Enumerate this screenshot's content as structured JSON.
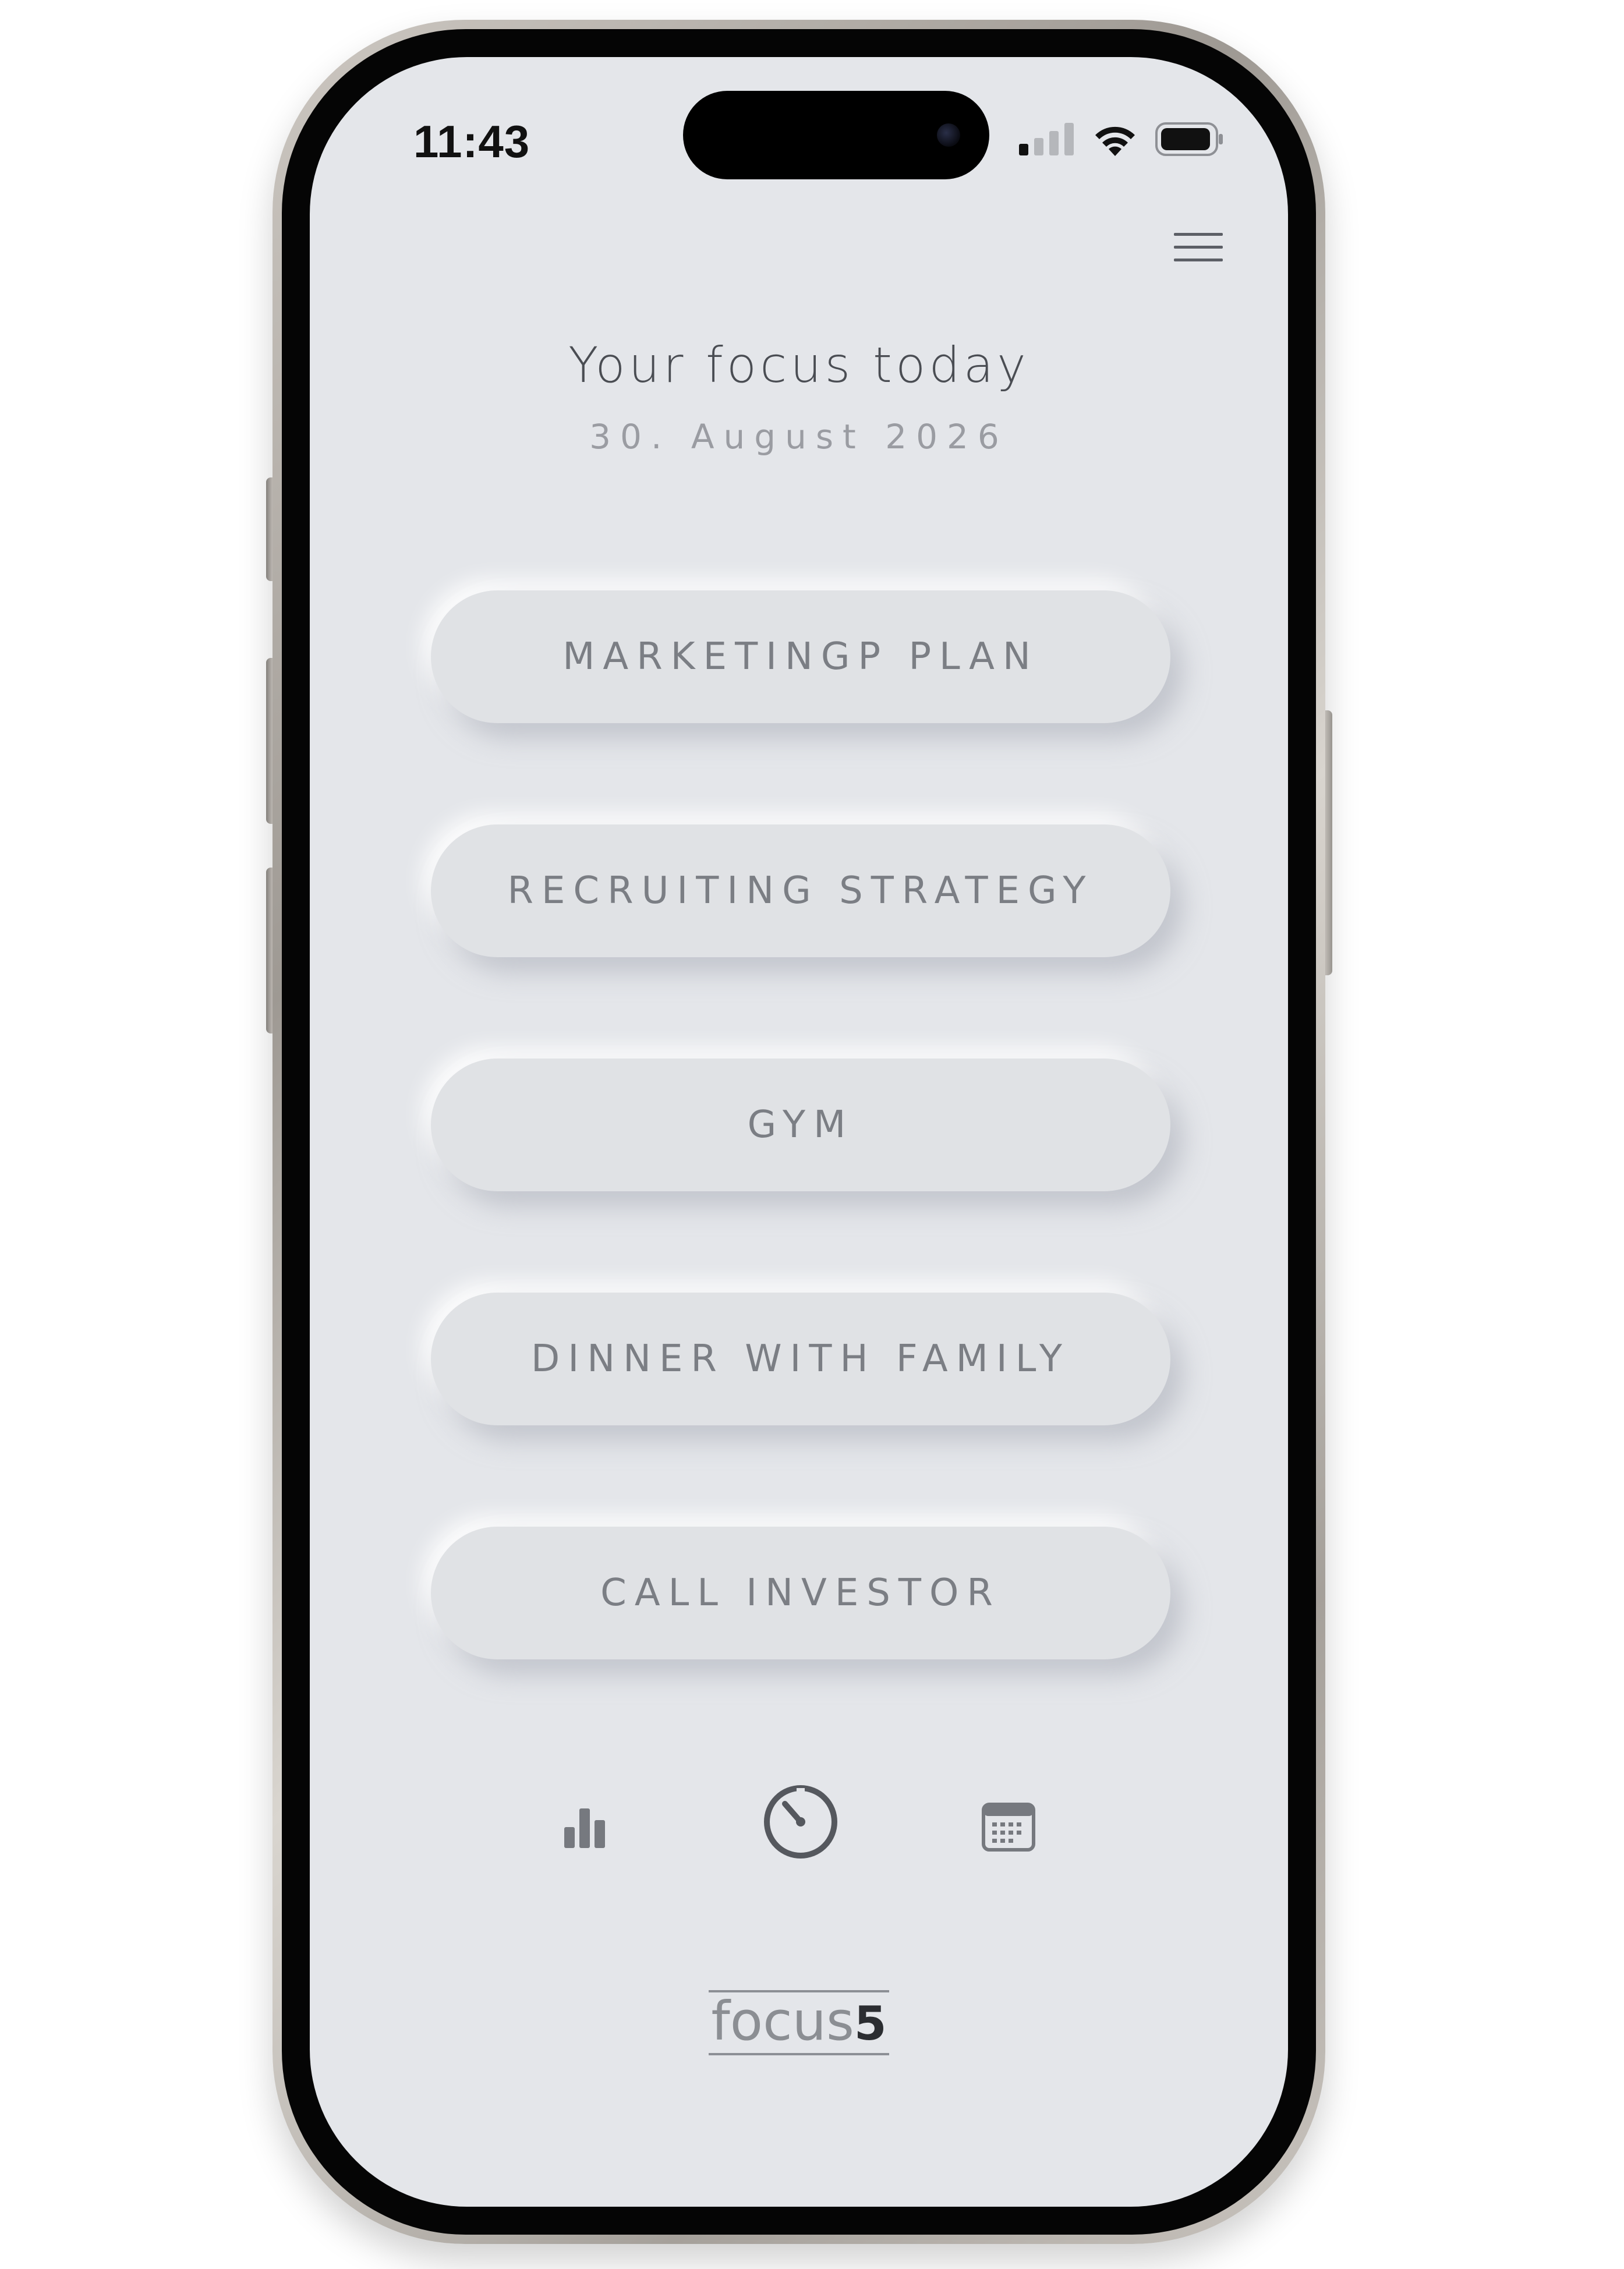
{
  "status_bar": {
    "time": "11:43",
    "icons": [
      "signal-icon",
      "wifi-icon",
      "battery-icon"
    ]
  },
  "header": {
    "menu_icon": "hamburger-menu-icon",
    "title": "Your focus today",
    "date": "30. August 2026"
  },
  "focus_items": [
    {
      "label": "MARKETINGP PLAN"
    },
    {
      "label": "RECRUITING STRATEGY"
    },
    {
      "label": "GYM"
    },
    {
      "label": "DINNER WITH FAMILY"
    },
    {
      "label": "CALL INVESTOR"
    }
  ],
  "bottom_nav": {
    "items": [
      {
        "icon": "bar-chart-icon"
      },
      {
        "icon": "timer-icon"
      },
      {
        "icon": "calendar-icon"
      }
    ]
  },
  "logo": {
    "word": "focus",
    "number": "5"
  },
  "colors": {
    "screen_background": "#e4e6ea",
    "pill_background": "#e0e2e5",
    "pill_text": "#7b7e84",
    "title_text": "#4a4d53",
    "date_text": "#9a9ca2",
    "icon_gray": "#76797f"
  }
}
